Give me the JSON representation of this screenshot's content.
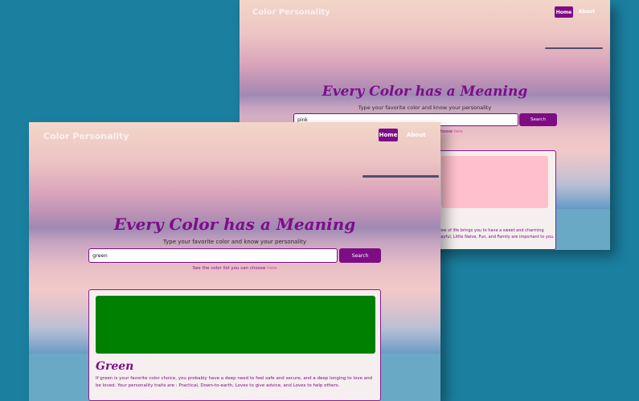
{
  "back_window": {
    "brand": "Color Personality",
    "nav": {
      "home": "Home",
      "about": "About"
    },
    "headline": "Every Color has a Meaning",
    "subtitle": "Type your favorite color and know your personality",
    "search_value": "pink",
    "search_button": "Search",
    "hint_visible": "hoose",
    "hint_link": "here",
    "swatch_color": "#ffc0cb",
    "desc_line1": "view of life brings you to have a sweet and charming",
    "desc_line2": "Playful, Little Naive, Fun, and Family are important to you."
  },
  "front_window": {
    "brand": "Color Personality",
    "nav": {
      "home": "Home",
      "about": "About"
    },
    "headline": "Every Color has a Meaning",
    "subtitle": "Type your favorite color and know your personality",
    "search_value": "green",
    "search_button": "Search",
    "hint_text": "See the color list you can choose",
    "hint_link": "here",
    "swatch_color": "#008000",
    "result_title": "Green",
    "result_desc": "If green is your favorite color choice, you probably have a deep need to feel safe and secure, and a deep longing to love and be loved. Your personality traits are : Practical, Down-to-earth, Loves to give advice, and Loves to help others."
  },
  "colors": {
    "background": "#1b7fa0",
    "accent": "#7d0c85"
  }
}
